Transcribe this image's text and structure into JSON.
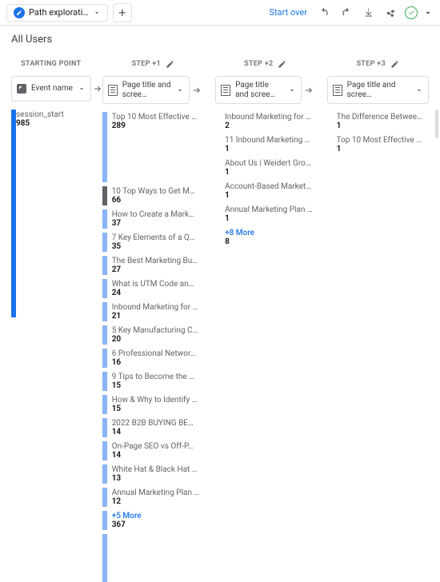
{
  "toolbar": {
    "tab_label": "Path explorati…",
    "start_over": "Start over"
  },
  "header": {
    "title": "All Users"
  },
  "columns": {
    "start": {
      "header": "STARTING POINT",
      "selector": "Event name"
    },
    "s1": {
      "header": "STEP +1",
      "selector": "Page title and scree…"
    },
    "s2": {
      "header": "STEP +2",
      "selector": "Page title and scree…"
    },
    "s3": {
      "header": "STEP +3",
      "selector": "Page title and scree…"
    }
  },
  "nodes": {
    "start": {
      "label": "session_start",
      "value": "985"
    },
    "s1": {
      "first": {
        "label": "Top 10 Most Effective …",
        "value": "289"
      },
      "second": {
        "label": "10 Top Ways to Get M…",
        "value": "66"
      },
      "rest": [
        {
          "label": "How to Create a Mark…",
          "value": "37"
        },
        {
          "label": "7 Key Elements of a Q…",
          "value": "35"
        },
        {
          "label": "The Best Marketing Bu…",
          "value": "27"
        },
        {
          "label": "What is UTM Code an…",
          "value": "24"
        },
        {
          "label": "Inbound Marketing for …",
          "value": "21"
        },
        {
          "label": "5 Key Manufacturing C…",
          "value": "20"
        },
        {
          "label": "6 Professional Networ…",
          "value": "16"
        },
        {
          "label": "9 Tips to Become the …",
          "value": "15"
        },
        {
          "label": "How & Why to Identify …",
          "value": "15"
        },
        {
          "label": "2022 B2B BUYING BE…",
          "value": "14"
        },
        {
          "label": "On-Page SEO vs Off-P…",
          "value": "14"
        },
        {
          "label": "White Hat & Black Hat …",
          "value": "13"
        },
        {
          "label": "Annual Marketing Plan …",
          "value": "12"
        }
      ],
      "more": {
        "label": "+5 More",
        "value": "367"
      }
    },
    "s2": {
      "items": [
        {
          "label": "Inbound Marketing for …",
          "value": "2"
        },
        {
          "label": "11 Inbound Marketing …",
          "value": "1"
        },
        {
          "label": "About Us | Weidert Gro…",
          "value": "1"
        },
        {
          "label": "Account-Based Market…",
          "value": "1"
        },
        {
          "label": "Annual Marketing Plan …",
          "value": "1"
        }
      ],
      "more": {
        "label": "+8 More",
        "value": "8"
      }
    },
    "s3": {
      "items": [
        {
          "label": "The Difference Betwee…",
          "value": "1"
        },
        {
          "label": "Top 10 Most Effective …",
          "value": "1"
        }
      ]
    }
  }
}
